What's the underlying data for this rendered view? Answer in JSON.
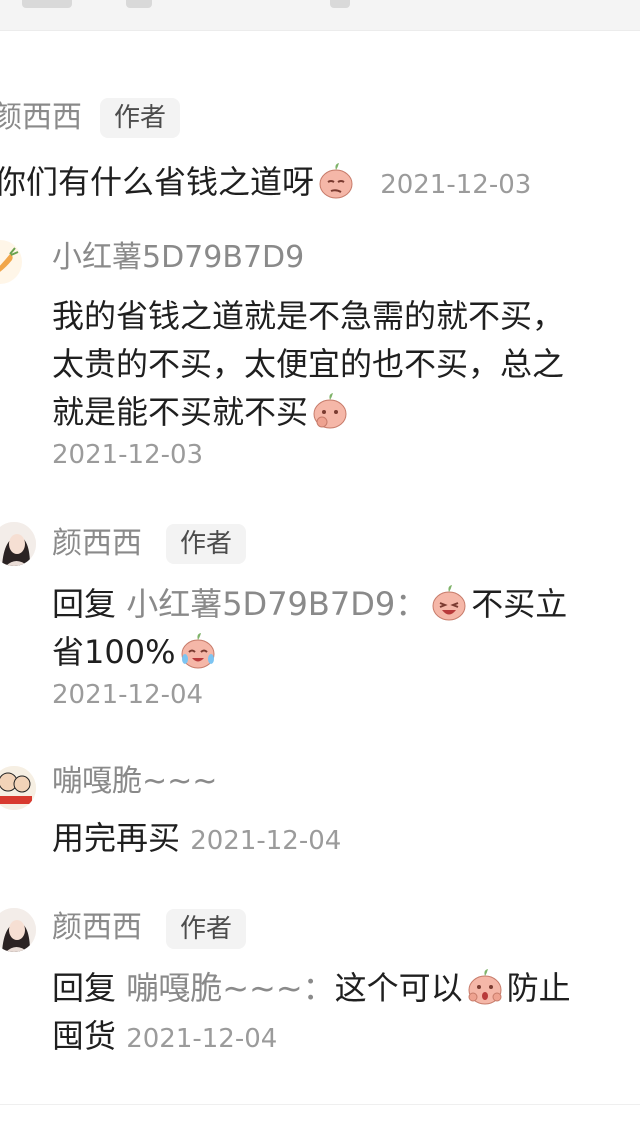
{
  "comments": [
    {
      "author": "颜西西",
      "tag": "作者",
      "text": "你们有什么省钱之道呀",
      "emoji": "peach-smirk-emoji",
      "date": "2021-12-03"
    },
    {
      "author": "小红薯5D79B7D9",
      "line1": "我的省钱之道就是不急需的就不买，",
      "line2": "太贵的不买，太便宜的也不买，总之",
      "line3": "就是能不买就不买",
      "emoji": "peach-thinking-emoji",
      "date": "2021-12-03"
    },
    {
      "author": "颜西西",
      "tag": "作者",
      "reply_word": "回复",
      "reply_to": "小红薯5D79B7D9：",
      "emoji1": "peach-laugh-emoji",
      "line1_tail": "不买立",
      "line2": "省100%",
      "emoji2": "peach-crying-laugh-emoji",
      "date": "2021-12-04"
    },
    {
      "author": "嘣嘎脆~~~",
      "text": "用完再买",
      "date": "2021-12-04"
    },
    {
      "author": "颜西西",
      "tag": "作者",
      "reply_word": "回复",
      "reply_to": "嘣嘎脆~~~：",
      "line1_mid": "这个可以",
      "emoji": "peach-surprised-emoji",
      "line1_tail": "防止",
      "line2": "囤货",
      "date": "2021-12-04"
    }
  ]
}
